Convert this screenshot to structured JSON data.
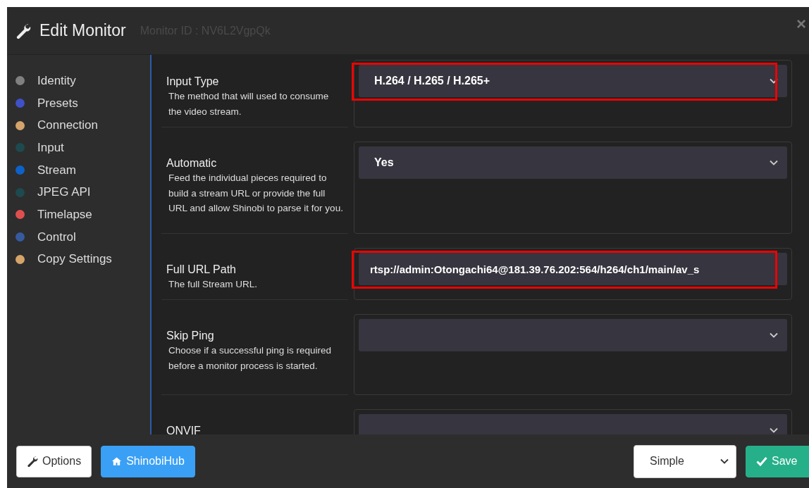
{
  "header": {
    "title": "Edit Monitor",
    "subtitle": "Monitor ID : NV6L2VgpQk",
    "close": "×"
  },
  "sidebar": {
    "items": [
      {
        "label": "Identity",
        "color": "#808080"
      },
      {
        "label": "Presets",
        "color": "#3f51c7"
      },
      {
        "label": "Connection",
        "color": "#d4a46a"
      },
      {
        "label": "Input",
        "color": "#1d4a4e"
      },
      {
        "label": "Stream",
        "color": "#0d62c9"
      },
      {
        "label": "JPEG API",
        "color": "#1d4a4e"
      },
      {
        "label": "Timelapse",
        "color": "#e04f4f"
      },
      {
        "label": "Control",
        "color": "#375a9e"
      },
      {
        "label": "Copy Settings",
        "color": "#d4a46a"
      }
    ]
  },
  "fields": [
    {
      "label": "Input Type",
      "description": "The method that will used to consume the video stream.",
      "kind": "select",
      "value": "H.264 / H.265 / H.265+",
      "highlighted": true
    },
    {
      "label": "Automatic",
      "description": "Feed the individual pieces required to build a stream URL or provide the full URL and allow Shinobi to parse it for you.",
      "kind": "select",
      "value": "Yes",
      "highlighted": false
    },
    {
      "label": "Full URL Path",
      "description": "The full Stream URL.",
      "kind": "text",
      "value": "rtsp://admin:Otongachi64@181.39.76.202:564/h264/ch1/main/av_s",
      "highlighted": true
    },
    {
      "label": "Skip Ping",
      "description": "Choose if a successful ping is required before a monitor process is started.",
      "kind": "select",
      "highlighted": false
    },
    {
      "label": "ONVIF",
      "kind": "select",
      "highlighted": false
    }
  ],
  "footer": {
    "options_button": "Options",
    "hub_button": "ShinobiHub",
    "mode_select": "Simple",
    "save_button": "Save"
  }
}
